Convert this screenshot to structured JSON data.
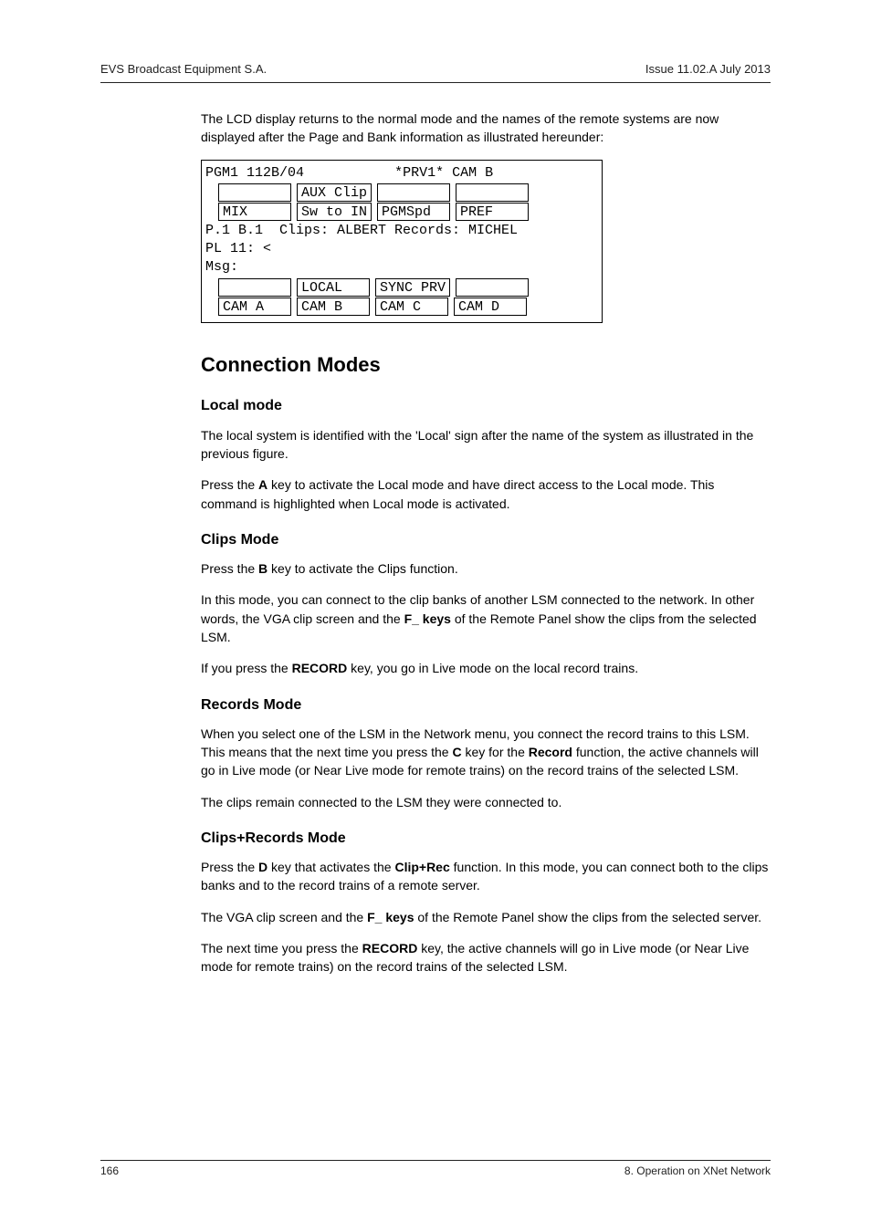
{
  "header": {
    "left": "EVS Broadcast Equipment S.A.",
    "right": "Issue 11.02.A  July 2013"
  },
  "intro": "The LCD display returns to the normal mode and the names of the remote systems are now displayed after the Page and Bank information as illustrated hereunder:",
  "lcd": {
    "line1_left": "PGM1 112B/04",
    "line1_right": "*PRV1* CAM B",
    "row2": {
      "c1": " ",
      "c2": "AUX Clip",
      "c3": " ",
      "c4": " "
    },
    "row3": {
      "c1": "MIX",
      "c2": "Sw to IN",
      "c3": "PGMSpd",
      "c4": "PREF"
    },
    "line4": "P.1 B.1  Clips: ALBERT Records: MICHEL",
    "line5": "PL 11: <",
    "line6": "Msg:",
    "row7": {
      "c1": " ",
      "c2": "LOCAL",
      "c3": "SYNC PRV",
      "c4": " "
    },
    "row8": {
      "c1": "CAM A",
      "c2": "CAM B",
      "c3": "CAM C",
      "c4": "CAM D"
    }
  },
  "h2": "Connection Modes",
  "local": {
    "title": "Local mode",
    "p1": "The local system is identified with the 'Local' sign after the name of the system as illustrated in the previous figure.",
    "p2a": "Press the ",
    "p2key": "A",
    "p2b": " key to activate the Local mode and have direct access to the Local mode. This command is highlighted when Local mode is activated."
  },
  "clips": {
    "title": "Clips Mode",
    "p1a": "Press the ",
    "p1key": "B",
    "p1b": " key to activate the Clips function.",
    "p2a": "In this mode, you can connect to the clip banks of another LSM connected to the network. In other words, the VGA clip screen and the ",
    "p2key": "F_ keys",
    "p2b": " of the Remote Panel show the clips from the selected LSM.",
    "p3a": "If you press the ",
    "p3key": "RECORD",
    "p3b": " key, you go in Live mode on the local record trains."
  },
  "records": {
    "title": "Records Mode",
    "p1a": "When you select one of the LSM in the Network menu, you connect the record trains to this LSM. This means that the next time you press the ",
    "p1key1": "C",
    "p1b": " key for the ",
    "p1key2": "Record",
    "p1c": " function, the active channels will go in Live mode (or Near Live mode for remote trains) on the record trains of the selected LSM.",
    "p2": "The clips remain connected to the LSM they were connected to."
  },
  "cr": {
    "title": "Clips+Records Mode",
    "p1a": "Press the ",
    "p1key1": "D",
    "p1b": " key that activates the ",
    "p1key2": "Clip+Rec",
    "p1c": " function. In this mode, you can connect both to the clips banks and to the record trains of a remote server.",
    "p2a": "The VGA clip screen and the ",
    "p2key": "F_ keys",
    "p2b": " of the Remote Panel show the clips from the selected server.",
    "p3a": "The next time you press the ",
    "p3key": "RECORD",
    "p3b": " key, the active channels will go in Live mode (or Near Live mode for remote trains) on the record trains of the selected LSM."
  },
  "footer": {
    "left": "166",
    "right": "8. Operation on XNet Network"
  }
}
